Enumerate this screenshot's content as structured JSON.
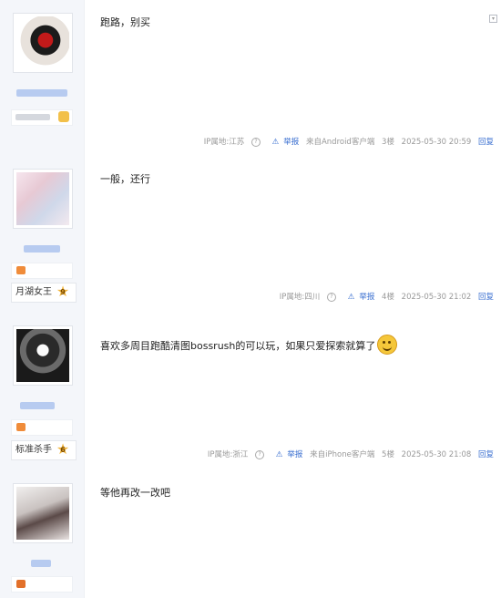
{
  "ui": {
    "corner_icon": "expand-icon",
    "report_icon": "warning-triangle-icon",
    "help_icon": "?"
  },
  "posts": [
    {
      "content": "跑路，别买",
      "ip": "IP属地:江苏",
      "report": "举报",
      "client": "来自Android客户端",
      "floor": "3楼",
      "time": "2025-05-30 20:59",
      "reply": "回复",
      "level_label": "",
      "level": ""
    },
    {
      "content": "一般，还行",
      "ip": "IP属地:四川",
      "report": "举报",
      "client": "",
      "floor": "4楼",
      "time": "2025-05-30 21:02",
      "reply": "回复",
      "level_label": "月湖女王",
      "level": "9"
    },
    {
      "content": "喜欢多周目跑酷清图bossrush的可以玩，如果只爱探索就算了",
      "ip": "IP属地:浙江",
      "report": "举报",
      "client": "来自iPhone客户端",
      "floor": "5楼",
      "time": "2025-05-30 21:08",
      "reply": "回复",
      "level_label": "标准杀手",
      "level": "6"
    },
    {
      "content": "等他再改一改吧"
    }
  ]
}
